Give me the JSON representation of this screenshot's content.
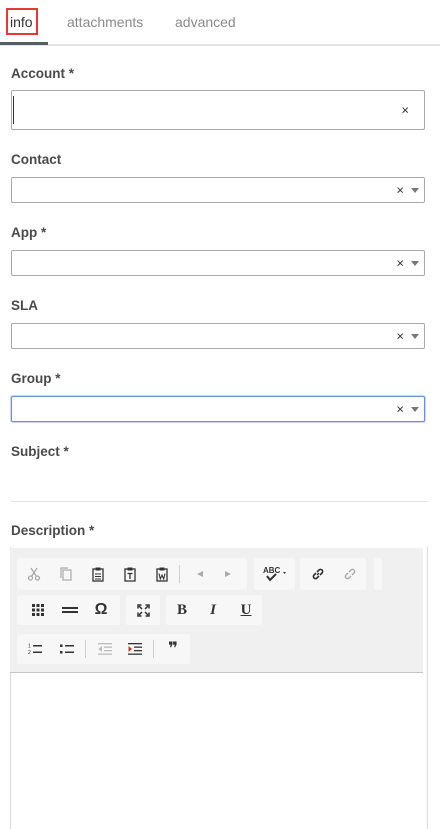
{
  "tabs": [
    {
      "label": "info"
    },
    {
      "label": "attachments"
    },
    {
      "label": "advanced"
    }
  ],
  "fields": {
    "account": {
      "label": "Account",
      "required": "*",
      "value": ""
    },
    "contact": {
      "label": "Contact",
      "value": ""
    },
    "app": {
      "label": "App",
      "required": "*",
      "value": ""
    },
    "sla": {
      "label": "SLA",
      "value": ""
    },
    "group": {
      "label": "Group",
      "required": "*",
      "value": ""
    },
    "subject": {
      "label": "Subject",
      "required": "*",
      "value": ""
    },
    "description": {
      "label": "Description",
      "required": "*"
    }
  },
  "clear_glyph": "×",
  "toolbar": {
    "bold": "B",
    "italic": "I",
    "underline": "U",
    "omega": "Ω",
    "spellcheck": "ABC",
    "blockquote": "❞"
  },
  "colors": {
    "highlight": "#e53935",
    "focus": "#6e8fd6"
  }
}
